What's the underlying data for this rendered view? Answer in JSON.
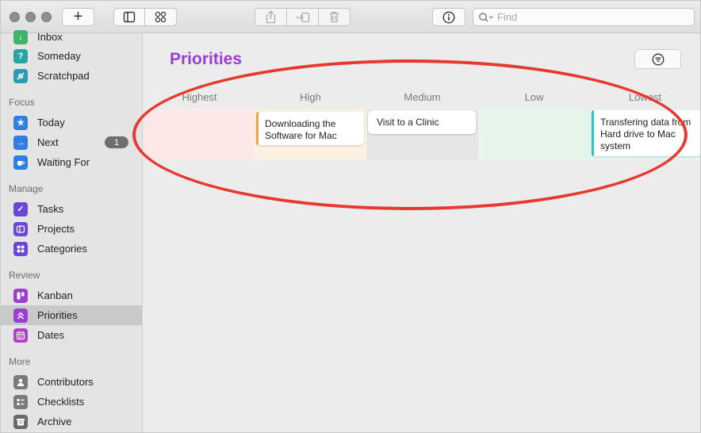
{
  "toolbar": {
    "add_label": "+",
    "search": {
      "placeholder": "Find",
      "value": ""
    }
  },
  "sidebar": {
    "top_items": [
      {
        "label": "Inbox",
        "icon": "inbox-icon",
        "color": "#3fb36b"
      },
      {
        "label": "Someday",
        "icon": "question-icon",
        "color": "#2aa3a3"
      },
      {
        "label": "Scratchpad",
        "icon": "scratchpad-icon",
        "color": "#2a9bb0"
      }
    ],
    "sections": [
      {
        "title": "Focus",
        "items": [
          {
            "label": "Today",
            "icon": "star-icon",
            "color": "#2f7fe0"
          },
          {
            "label": "Next",
            "icon": "arrow-right-icon",
            "color": "#2f7fe0",
            "badge": "1"
          },
          {
            "label": "Waiting For",
            "icon": "coffee-icon",
            "color": "#2f7fe0"
          }
        ]
      },
      {
        "title": "Manage",
        "items": [
          {
            "label": "Tasks",
            "icon": "checkmark-icon",
            "color": "#6a45d8"
          },
          {
            "label": "Projects",
            "icon": "projects-icon",
            "color": "#6a45d8"
          },
          {
            "label": "Categories",
            "icon": "categories-icon",
            "color": "#6a45d8"
          }
        ]
      },
      {
        "title": "Review",
        "items": [
          {
            "label": "Kanban",
            "icon": "kanban-icon",
            "color": "#9b3fd1"
          },
          {
            "label": "Priorities",
            "icon": "chevrons-up-icon",
            "color": "#9b3fd1"
          },
          {
            "label": "Dates",
            "icon": "calendar-icon",
            "color": "#b33fc9"
          }
        ]
      },
      {
        "title": "More",
        "items": [
          {
            "label": "Contributors",
            "icon": "person-icon",
            "color": "#7a7a7a"
          },
          {
            "label": "Checklists",
            "icon": "checklist-icon",
            "color": "#7a7a7a"
          },
          {
            "label": "Archive",
            "icon": "archive-icon",
            "color": "#6a6a6a"
          }
        ]
      }
    ],
    "active": "Priorities"
  },
  "main": {
    "title": "Priorities",
    "title_color": "#9b3fd1",
    "columns": [
      {
        "label": "Highest",
        "tint": "#fde8e8",
        "cards": []
      },
      {
        "label": "High",
        "tint": "#fdf1e2",
        "cards": [
          {
            "text": "Downloading the Software for Mac",
            "accent": "#f0a340"
          }
        ]
      },
      {
        "label": "Medium",
        "tint": "#e6e6e6",
        "cards": [
          {
            "text": "Visit to a Clinic",
            "accent": ""
          }
        ]
      },
      {
        "label": "Low",
        "tint": "#e6f5ea",
        "cards": []
      },
      {
        "label": "Lowest",
        "tint": "#e3f5f5",
        "cards": [
          {
            "text": "Transfering data from Hard drive to Mac system",
            "accent": "#36c1c4"
          }
        ]
      }
    ]
  },
  "annotation_color": "#e8382d"
}
